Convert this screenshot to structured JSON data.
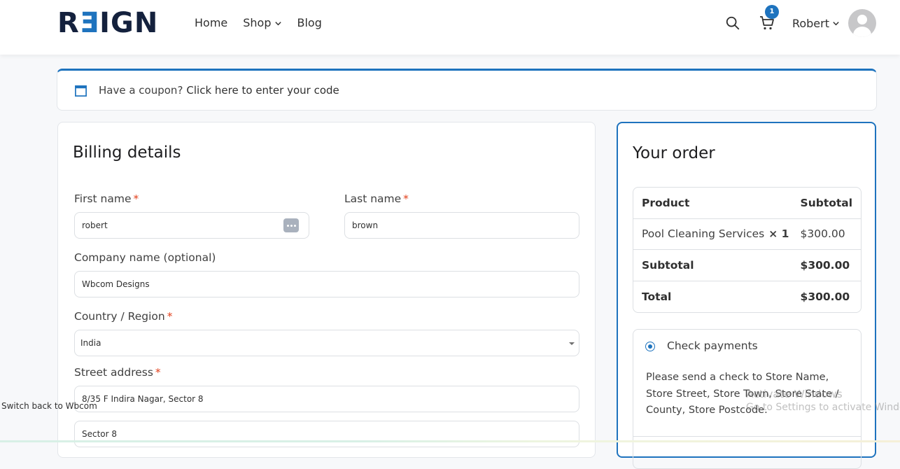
{
  "header": {
    "logo_prefix": "R",
    "logo_e": "Ǝ",
    "logo_suffix": "IGN",
    "nav": [
      {
        "label": "Home"
      },
      {
        "label": "Shop"
      },
      {
        "label": "Blog"
      }
    ],
    "cart_count": "1",
    "user_name": "Robert"
  },
  "coupon": {
    "text": "Have a coupon?",
    "link": "Click here to enter your code"
  },
  "billing": {
    "title": "Billing details",
    "first_name_label": "First name",
    "first_name_value": "robert",
    "last_name_label": "Last name",
    "last_name_value": "brown",
    "company_label": "Company name (optional)",
    "company_value": "Wbcom Designs",
    "country_label": "Country / Region",
    "country_value": "India",
    "street_label": "Street address",
    "street_value_1": "8/35 F Indira Nagar, Sector 8",
    "street_value_2": "Sector 8",
    "required_mark": "*"
  },
  "switch_back": "Switch back to Wbcom",
  "order": {
    "title": "Your order",
    "col_product": "Product",
    "col_subtotal": "Subtotal",
    "item_name": "Pool Cleaning Services",
    "item_qty": "× 1",
    "item_price": "$300.00",
    "subtotal_label": "Subtotal",
    "subtotal_value": "$300.00",
    "total_label": "Total",
    "total_value": "$300.00",
    "payment_label": "Check payments",
    "payment_desc": "Please send a check to Store Name, Store Street, Store Town, Store State / County, Store Postcode."
  },
  "watermark": {
    "line1": "Activate Windows",
    "line2": "Go to Settings to activate Windows."
  },
  "colors": {
    "accent": "#1e73be",
    "required": "#e2401c",
    "logo_dark": "#14213d"
  }
}
